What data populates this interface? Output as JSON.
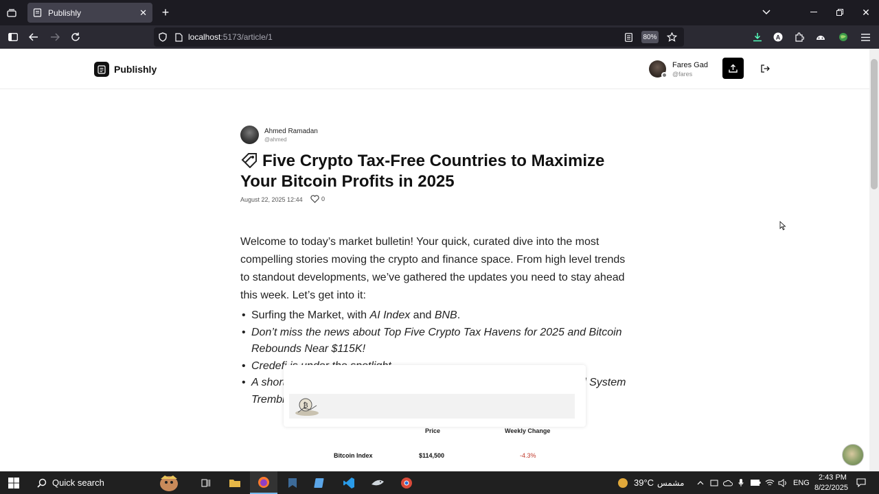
{
  "browser": {
    "tab_title": "Publishly",
    "url_host": "localhost",
    "url_path": ":5173/article/1",
    "zoom": "80%"
  },
  "site": {
    "brand": "Publishly",
    "user": {
      "name": "Fares Gad",
      "handle": "@fares"
    }
  },
  "article": {
    "author": {
      "name": "Ahmed Ramadan",
      "handle": "@ahmed"
    },
    "title": "Five Crypto Tax-Free Countries to Maximize Your Bitcoin Profits in 2025",
    "date": "August 22, 2025 12:44",
    "likes": "0",
    "intro": "Welcome to today’s market bulletin! Your quick, curated dive into the most compelling stories moving the crypto and finance space. From high level trends to standout developments, we’ve gathered the updates you need to stay ahead this week. Let’s get into it:",
    "bullets": {
      "b1_prefix": "Surfing the Market, with ",
      "b1_em1": "AI Index",
      "b1_and": " and ",
      "b1_em2": "BNB",
      "b1_end": ".",
      "b2": "Don’t miss the news about Top Five Crypto Tax Havens for 2025 and Bitcoin Rebounds Near $115K!",
      "b3": "Credefi is under the spotlight.",
      "b4": "A short article about The Subprime Crisis: When the Global Financial System Trembled."
    },
    "table": {
      "headers": {
        "price": "Price",
        "change": "Weekly Change"
      },
      "rows": [
        {
          "name": "Bitcoin Index",
          "price": "$114,500",
          "change": "-4.3%"
        }
      ]
    }
  },
  "taskbar": {
    "search_label": "Quick search",
    "weather_temp": "39°C",
    "weather_desc": "مشمس",
    "lang": "ENG",
    "time": "2:43 PM",
    "date": "8/22/2025"
  }
}
